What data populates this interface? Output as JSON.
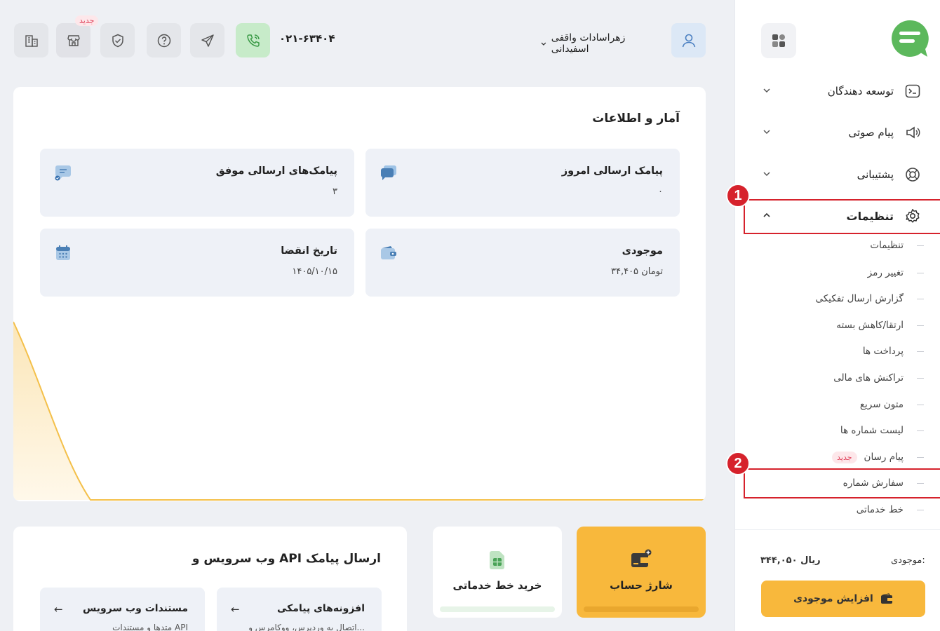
{
  "sidebar": {
    "nav": [
      {
        "label": "توسعه دهندگان",
        "icon": "terminal-icon"
      },
      {
        "label": "پیام صوتی",
        "icon": "speaker-icon"
      },
      {
        "label": "پشتیبانی",
        "icon": "lifebuoy-icon"
      },
      {
        "label": "تنظیمات",
        "icon": "gear-icon"
      }
    ],
    "submenu": [
      {
        "label": "تنظیمات"
      },
      {
        "label": "تغییر رمز"
      },
      {
        "label": "گزارش ارسال تفکیکی"
      },
      {
        "label": "ارتقا/کاهش بسته"
      },
      {
        "label": "پرداخت ها"
      },
      {
        "label": "تراکنش های مالی"
      },
      {
        "label": "متون سریع"
      },
      {
        "label": "لیست شماره ها"
      },
      {
        "label": "پیام رسان",
        "badge": "جدید"
      },
      {
        "label": "سفارش شماره"
      },
      {
        "label": "خط خدماتی"
      }
    ],
    "balance_label": "موجودی:",
    "balance_value": "۳۴۴,۰۵۰ ریال",
    "increase_button": "افزایش موجودی"
  },
  "annotations": {
    "one": "1",
    "two": "2"
  },
  "header": {
    "username": "زهراسادات واقفی اسفیدانی",
    "phone": "۰۲۱-۶۳۴۰۴",
    "new_badge": "جدید"
  },
  "stats": {
    "title": "آمار و اطلاعات",
    "cards": [
      {
        "title": "پیامک ارسالی امروز",
        "value": "۰"
      },
      {
        "title": "پیامک‌های ارسالی موفق",
        "value": "۳"
      },
      {
        "title": "موجودی",
        "value": "۳۴,۴۰۵ تومان"
      },
      {
        "title": "تاریخ انقضا",
        "value": "۱۴۰۵/۱۰/۱۵"
      }
    ]
  },
  "quick": {
    "charge": "شارژ حساب",
    "buy_line": "خرید خط خدماتی"
  },
  "api": {
    "title": "وب سرویس و API ارسال پیامک",
    "cards": [
      {
        "title": "افزونه‌های پیامکی",
        "desc": "اتصال به وردپرس، ووکامرس و..."
      },
      {
        "title": "مستندات وب سرویس",
        "desc": "متدها و مستندات API"
      }
    ]
  },
  "colors": {
    "accent": "#f8b83c",
    "brand_green": "#5cb85c",
    "annotation_red": "#d6222c"
  }
}
